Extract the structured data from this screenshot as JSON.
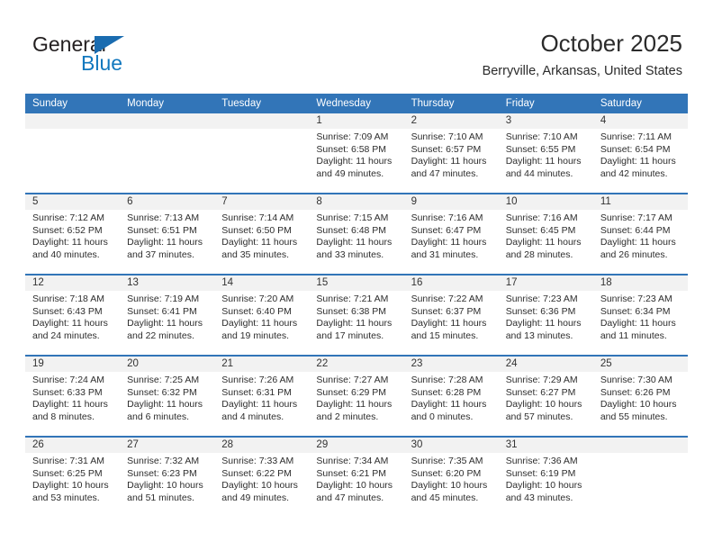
{
  "brand": {
    "name_part1": "General",
    "name_part2": "Blue",
    "mark": "triangle-flag-icon",
    "accent_color": "#1a6cb0",
    "text_color": "#231f20"
  },
  "header": {
    "title": "October 2025",
    "location": "Berryville, Arkansas, United States"
  },
  "theme": {
    "header_blue": "#3275b8",
    "daynum_band": "#f2f2f2",
    "page_background": "#ffffff"
  },
  "calendar": {
    "weekday_headers": [
      "Sunday",
      "Monday",
      "Tuesday",
      "Wednesday",
      "Thursday",
      "Friday",
      "Saturday"
    ],
    "weeks": [
      [
        {
          "day": "",
          "empty": true,
          "sunrise": "",
          "sunset": "",
          "daylight1": "",
          "daylight2": ""
        },
        {
          "day": "",
          "empty": true,
          "sunrise": "",
          "sunset": "",
          "daylight1": "",
          "daylight2": ""
        },
        {
          "day": "",
          "empty": true,
          "sunrise": "",
          "sunset": "",
          "daylight1": "",
          "daylight2": ""
        },
        {
          "day": "1",
          "sunrise": "Sunrise: 7:09 AM",
          "sunset": "Sunset: 6:58 PM",
          "daylight1": "Daylight: 11 hours",
          "daylight2": "and 49 minutes."
        },
        {
          "day": "2",
          "sunrise": "Sunrise: 7:10 AM",
          "sunset": "Sunset: 6:57 PM",
          "daylight1": "Daylight: 11 hours",
          "daylight2": "and 47 minutes."
        },
        {
          "day": "3",
          "sunrise": "Sunrise: 7:10 AM",
          "sunset": "Sunset: 6:55 PM",
          "daylight1": "Daylight: 11 hours",
          "daylight2": "and 44 minutes."
        },
        {
          "day": "4",
          "sunrise": "Sunrise: 7:11 AM",
          "sunset": "Sunset: 6:54 PM",
          "daylight1": "Daylight: 11 hours",
          "daylight2": "and 42 minutes."
        }
      ],
      [
        {
          "day": "5",
          "sunrise": "Sunrise: 7:12 AM",
          "sunset": "Sunset: 6:52 PM",
          "daylight1": "Daylight: 11 hours",
          "daylight2": "and 40 minutes."
        },
        {
          "day": "6",
          "sunrise": "Sunrise: 7:13 AM",
          "sunset": "Sunset: 6:51 PM",
          "daylight1": "Daylight: 11 hours",
          "daylight2": "and 37 minutes."
        },
        {
          "day": "7",
          "sunrise": "Sunrise: 7:14 AM",
          "sunset": "Sunset: 6:50 PM",
          "daylight1": "Daylight: 11 hours",
          "daylight2": "and 35 minutes."
        },
        {
          "day": "8",
          "sunrise": "Sunrise: 7:15 AM",
          "sunset": "Sunset: 6:48 PM",
          "daylight1": "Daylight: 11 hours",
          "daylight2": "and 33 minutes."
        },
        {
          "day": "9",
          "sunrise": "Sunrise: 7:16 AM",
          "sunset": "Sunset: 6:47 PM",
          "daylight1": "Daylight: 11 hours",
          "daylight2": "and 31 minutes."
        },
        {
          "day": "10",
          "sunrise": "Sunrise: 7:16 AM",
          "sunset": "Sunset: 6:45 PM",
          "daylight1": "Daylight: 11 hours",
          "daylight2": "and 28 minutes."
        },
        {
          "day": "11",
          "sunrise": "Sunrise: 7:17 AM",
          "sunset": "Sunset: 6:44 PM",
          "daylight1": "Daylight: 11 hours",
          "daylight2": "and 26 minutes."
        }
      ],
      [
        {
          "day": "12",
          "sunrise": "Sunrise: 7:18 AM",
          "sunset": "Sunset: 6:43 PM",
          "daylight1": "Daylight: 11 hours",
          "daylight2": "and 24 minutes."
        },
        {
          "day": "13",
          "sunrise": "Sunrise: 7:19 AM",
          "sunset": "Sunset: 6:41 PM",
          "daylight1": "Daylight: 11 hours",
          "daylight2": "and 22 minutes."
        },
        {
          "day": "14",
          "sunrise": "Sunrise: 7:20 AM",
          "sunset": "Sunset: 6:40 PM",
          "daylight1": "Daylight: 11 hours",
          "daylight2": "and 19 minutes."
        },
        {
          "day": "15",
          "sunrise": "Sunrise: 7:21 AM",
          "sunset": "Sunset: 6:38 PM",
          "daylight1": "Daylight: 11 hours",
          "daylight2": "and 17 minutes."
        },
        {
          "day": "16",
          "sunrise": "Sunrise: 7:22 AM",
          "sunset": "Sunset: 6:37 PM",
          "daylight1": "Daylight: 11 hours",
          "daylight2": "and 15 minutes."
        },
        {
          "day": "17",
          "sunrise": "Sunrise: 7:23 AM",
          "sunset": "Sunset: 6:36 PM",
          "daylight1": "Daylight: 11 hours",
          "daylight2": "and 13 minutes."
        },
        {
          "day": "18",
          "sunrise": "Sunrise: 7:23 AM",
          "sunset": "Sunset: 6:34 PM",
          "daylight1": "Daylight: 11 hours",
          "daylight2": "and 11 minutes."
        }
      ],
      [
        {
          "day": "19",
          "sunrise": "Sunrise: 7:24 AM",
          "sunset": "Sunset: 6:33 PM",
          "daylight1": "Daylight: 11 hours",
          "daylight2": "and 8 minutes."
        },
        {
          "day": "20",
          "sunrise": "Sunrise: 7:25 AM",
          "sunset": "Sunset: 6:32 PM",
          "daylight1": "Daylight: 11 hours",
          "daylight2": "and 6 minutes."
        },
        {
          "day": "21",
          "sunrise": "Sunrise: 7:26 AM",
          "sunset": "Sunset: 6:31 PM",
          "daylight1": "Daylight: 11 hours",
          "daylight2": "and 4 minutes."
        },
        {
          "day": "22",
          "sunrise": "Sunrise: 7:27 AM",
          "sunset": "Sunset: 6:29 PM",
          "daylight1": "Daylight: 11 hours",
          "daylight2": "and 2 minutes."
        },
        {
          "day": "23",
          "sunrise": "Sunrise: 7:28 AM",
          "sunset": "Sunset: 6:28 PM",
          "daylight1": "Daylight: 11 hours",
          "daylight2": "and 0 minutes."
        },
        {
          "day": "24",
          "sunrise": "Sunrise: 7:29 AM",
          "sunset": "Sunset: 6:27 PM",
          "daylight1": "Daylight: 10 hours",
          "daylight2": "and 57 minutes."
        },
        {
          "day": "25",
          "sunrise": "Sunrise: 7:30 AM",
          "sunset": "Sunset: 6:26 PM",
          "daylight1": "Daylight: 10 hours",
          "daylight2": "and 55 minutes."
        }
      ],
      [
        {
          "day": "26",
          "sunrise": "Sunrise: 7:31 AM",
          "sunset": "Sunset: 6:25 PM",
          "daylight1": "Daylight: 10 hours",
          "daylight2": "and 53 minutes."
        },
        {
          "day": "27",
          "sunrise": "Sunrise: 7:32 AM",
          "sunset": "Sunset: 6:23 PM",
          "daylight1": "Daylight: 10 hours",
          "daylight2": "and 51 minutes."
        },
        {
          "day": "28",
          "sunrise": "Sunrise: 7:33 AM",
          "sunset": "Sunset: 6:22 PM",
          "daylight1": "Daylight: 10 hours",
          "daylight2": "and 49 minutes."
        },
        {
          "day": "29",
          "sunrise": "Sunrise: 7:34 AM",
          "sunset": "Sunset: 6:21 PM",
          "daylight1": "Daylight: 10 hours",
          "daylight2": "and 47 minutes."
        },
        {
          "day": "30",
          "sunrise": "Sunrise: 7:35 AM",
          "sunset": "Sunset: 6:20 PM",
          "daylight1": "Daylight: 10 hours",
          "daylight2": "and 45 minutes."
        },
        {
          "day": "31",
          "sunrise": "Sunrise: 7:36 AM",
          "sunset": "Sunset: 6:19 PM",
          "daylight1": "Daylight: 10 hours",
          "daylight2": "and 43 minutes."
        },
        {
          "day": "",
          "empty": true,
          "sunrise": "",
          "sunset": "",
          "daylight1": "",
          "daylight2": ""
        }
      ]
    ]
  }
}
